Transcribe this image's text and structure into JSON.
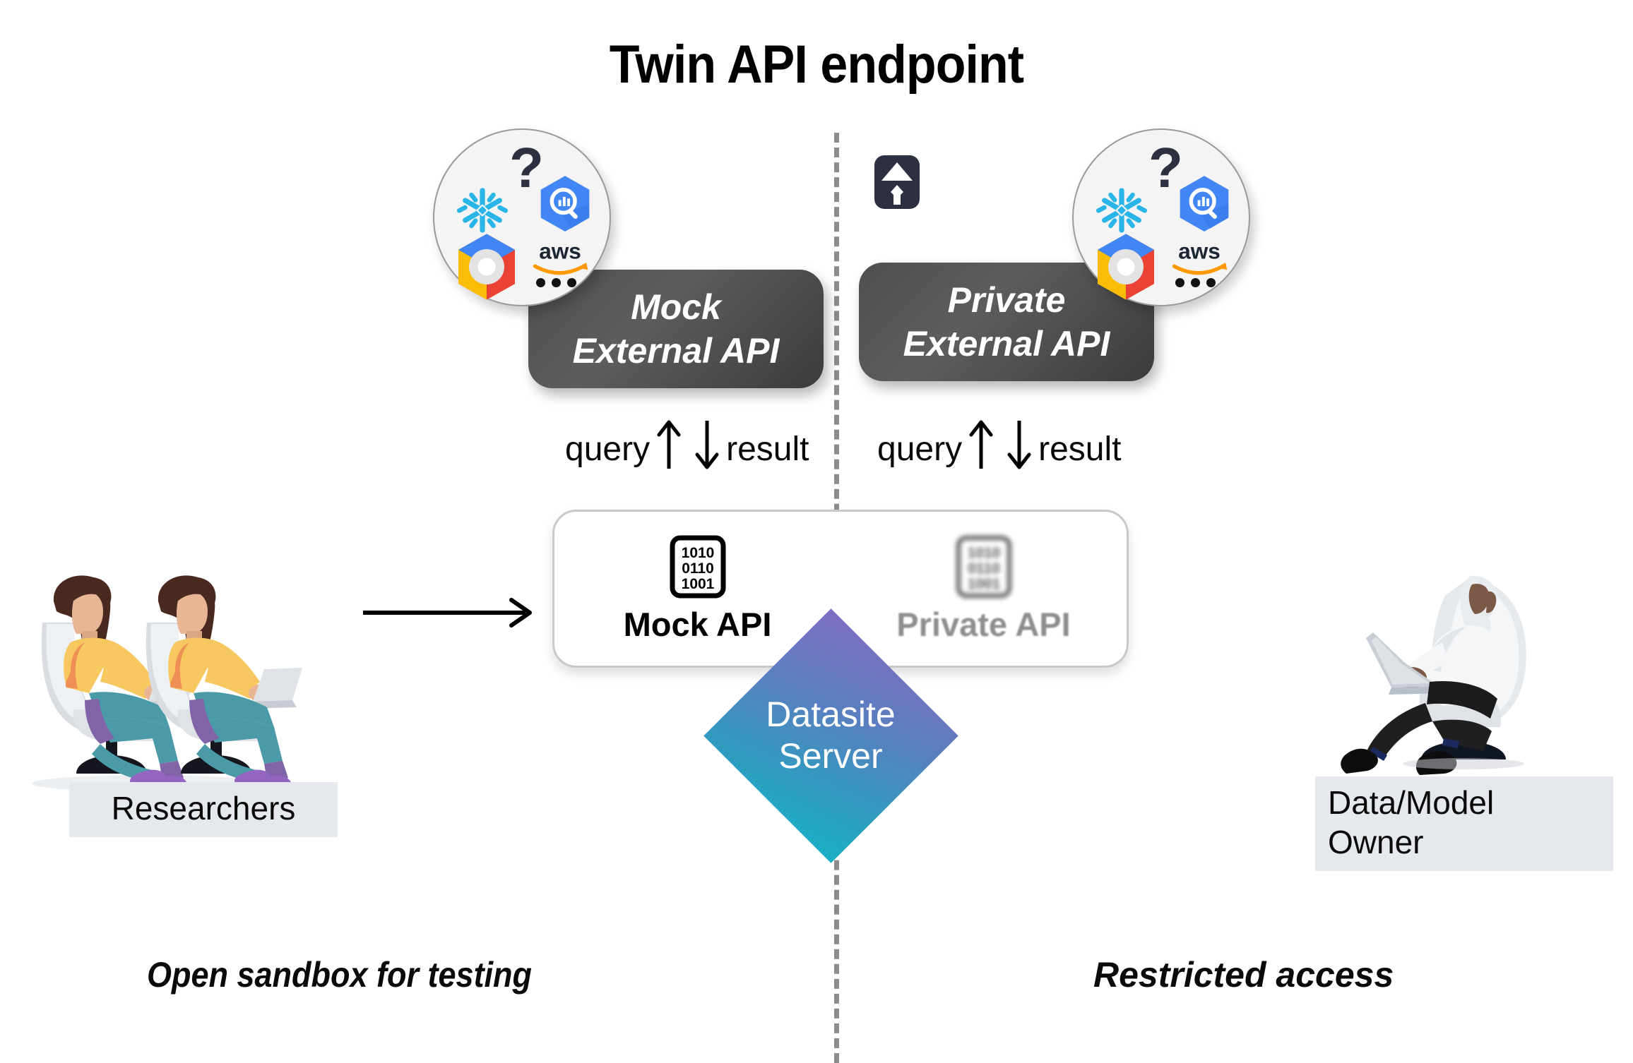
{
  "title": "Twin API endpoint",
  "divider": {
    "style": "dashed",
    "color": "#8c8c8c"
  },
  "left_panel": {
    "caption": "Open sandbox for testing",
    "external_api_box": {
      "line1": "Mock",
      "line2": "External API"
    },
    "flow_labels": {
      "up": "query",
      "down": "result"
    },
    "cloud_circle": {
      "icons": [
        "snowflake-icon",
        "question-mark-icon",
        "bigquery-icon",
        "google-cloud-icon",
        "aws-icon",
        "ellipsis-icon"
      ]
    },
    "api_card_half": {
      "label": "Mock API",
      "icon": "binary-document-icon",
      "binary_rows": [
        "1010",
        "0110",
        "1001"
      ]
    },
    "actor": {
      "label": "Researchers",
      "icon": "two-researchers-illustration"
    }
  },
  "right_panel": {
    "caption": "Restricted access",
    "external_api_box": {
      "line1": "Private",
      "line2": "External API"
    },
    "flow_labels": {
      "up": "query",
      "down": "result"
    },
    "cloud_circle": {
      "icons": [
        "snowflake-icon",
        "question-mark-icon",
        "bigquery-icon",
        "google-cloud-icon",
        "aws-icon",
        "ellipsis-icon"
      ]
    },
    "api_card_half": {
      "label": "Private API",
      "icon": "binary-document-icon-blurred",
      "binary_rows": [
        "1010",
        "0110",
        "1001"
      ]
    },
    "actor": {
      "label": "Data/Model\nOwner",
      "label_line1": "Data/Model",
      "label_line2": "Owner",
      "icon": "data-owner-illustration"
    },
    "lock": {
      "icon": "lock-icon",
      "color": "#2c3040"
    }
  },
  "center": {
    "server_line1": "Datasite",
    "server_line2": "Server",
    "gradient_top": "#7d6dc2",
    "gradient_bottom": "#19b0c4"
  },
  "flow_arrow": {
    "from": "researchers",
    "to": "api-card",
    "direction": "right"
  },
  "colors": {
    "box_dark": "#4f4f4f",
    "card_border": "#c9c9c9",
    "label_bg": "#e5e8ec",
    "snowflake": "#29b5e8",
    "bigquery": "#4285f4",
    "aws_orange": "#ff9900"
  }
}
